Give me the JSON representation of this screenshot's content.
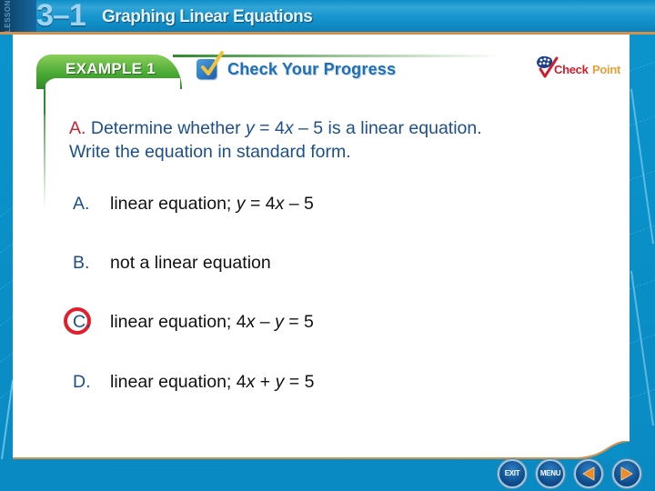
{
  "header": {
    "lesson_label": "LESSON",
    "lesson_number": "3–1",
    "lesson_title": "Graphing Linear Equations"
  },
  "banner": {
    "example_label": "EXAMPLE 1",
    "section_title": "Check Your Progress",
    "logo": {
      "part1": "Check",
      "part2": "Point",
      "icon": "checkpoint-logo-icon"
    }
  },
  "question": {
    "part_letter": "A.",
    "text_before": " Determine whether ",
    "var_y": "y",
    "text_mid1": " = 4",
    "var_x": "x",
    "text_mid2": " – 5 is a linear equation.",
    "line2": "Write the equation in standard form."
  },
  "options": [
    {
      "letter": "A.",
      "text": "linear equation; ",
      "eq": [
        {
          "t": "y",
          "i": true
        },
        {
          "t": " = 4",
          "i": false
        },
        {
          "t": "x",
          "i": true
        },
        {
          "t": " – 5",
          "i": false
        }
      ],
      "selected": false
    },
    {
      "letter": "B.",
      "text": "not a linear equation",
      "eq": [],
      "selected": false
    },
    {
      "letter": "C.",
      "text": "linear equation; ",
      "eq": [
        {
          "t": "4",
          "i": false
        },
        {
          "t": "x",
          "i": true
        },
        {
          "t": " – ",
          "i": false
        },
        {
          "t": "y",
          "i": true
        },
        {
          "t": " = 5",
          "i": false
        }
      ],
      "selected": true
    },
    {
      "letter": "D.",
      "text": "linear equation; ",
      "eq": [
        {
          "t": "4",
          "i": false
        },
        {
          "t": "x",
          "i": true
        },
        {
          "t": " + ",
          "i": false
        },
        {
          "t": "y",
          "i": true
        },
        {
          "t": " = 5",
          "i": false
        }
      ],
      "selected": false
    }
  ],
  "nav": {
    "exit_label": "EXIT",
    "menu_label": "MENU",
    "prev_icon": "triangle-left-icon",
    "next_icon": "triangle-right-icon"
  },
  "colors": {
    "background_blue": "#0a8ec6",
    "accent_orange": "#d48f4a",
    "question_blue": "#1d4f8c",
    "question_red": "#c8202f",
    "answer_circle_red": "#e0202e",
    "example_green": "#4aa935",
    "nav_arrow_orange": "#f08a24"
  }
}
